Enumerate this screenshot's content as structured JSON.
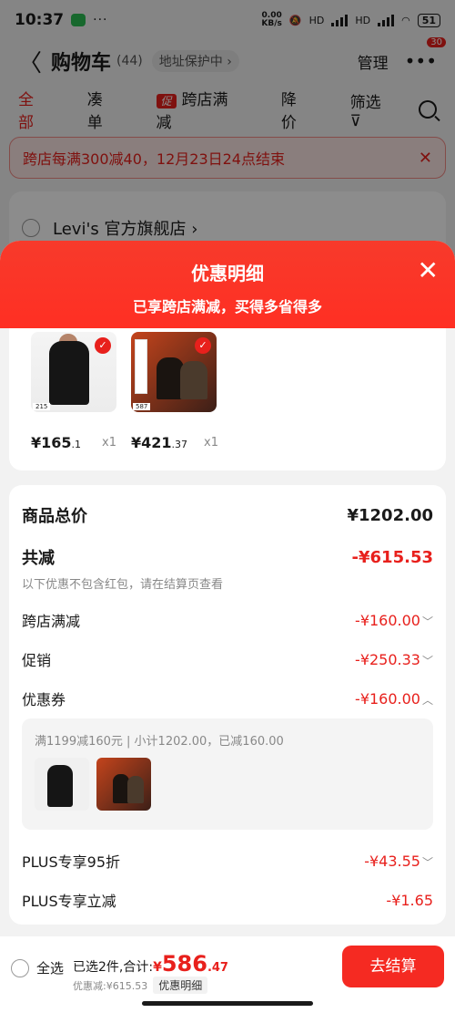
{
  "status": {
    "time": "10:37",
    "dots": "···",
    "speed_top": "0.00",
    "speed_bottom": "KB/s",
    "net1": "HD",
    "net2": "HD",
    "battery": "51"
  },
  "nav": {
    "back": "〈",
    "title": "购物车",
    "count": "(44)",
    "address": "地址保护中 ›",
    "manage": "管理",
    "more": "•••",
    "badge": "30"
  },
  "tabs": [
    {
      "label": "全部"
    },
    {
      "label": "凑单"
    },
    {
      "label": "跨店满减",
      "promo_tag": "促"
    },
    {
      "label": "降价"
    }
  ],
  "filter": {
    "label": "筛选",
    "icon": "⊽"
  },
  "promo_banner": {
    "text": "跨店每满300减40，12月23日24点结束",
    "close": "✕"
  },
  "store": {
    "name": "Levi's 官方旗舰店 ›"
  },
  "sheet": {
    "title": "优惠明细",
    "subtitle": "已享跨店满减，买得多省得多",
    "close": "✕"
  },
  "products": [
    {
      "price_main": "¥165",
      "price_dec": ".1",
      "qty": "x1",
      "img_num": "215"
    },
    {
      "price_main": "¥421",
      "price_dec": ".37",
      "qty": "x1",
      "img_num": "587"
    }
  ],
  "summary": {
    "total_label": "商品总价",
    "total_value": "¥1202.00",
    "saved_label": "共减",
    "saved_value": "-¥615.53",
    "note": "以下优惠不包含红包，请在结算页查看",
    "lines": [
      {
        "label": "跨店满减",
        "value": "-¥160.00",
        "chev": "﹀"
      },
      {
        "label": "促销",
        "value": "-¥250.33",
        "chev": "﹀"
      },
      {
        "label": "优惠券",
        "value": "-¥160.00",
        "chev": "︿"
      },
      {
        "label": "PLUS专享95折",
        "value": "-¥43.55",
        "chev": "﹀"
      },
      {
        "label": "PLUS专享立减",
        "value": "-¥1.65",
        "chev": ""
      }
    ],
    "coupon_detail": "满1199减160元 | 小计1202.00，已减160.00"
  },
  "bottom": {
    "select_all": "全选",
    "selected": "已选2件,合计:",
    "yen": "¥",
    "price_int": "586",
    "price_dec": ".47",
    "discount": "优惠减:¥615.53",
    "detail_chip": "优惠明细",
    "checkout": "去结算"
  }
}
